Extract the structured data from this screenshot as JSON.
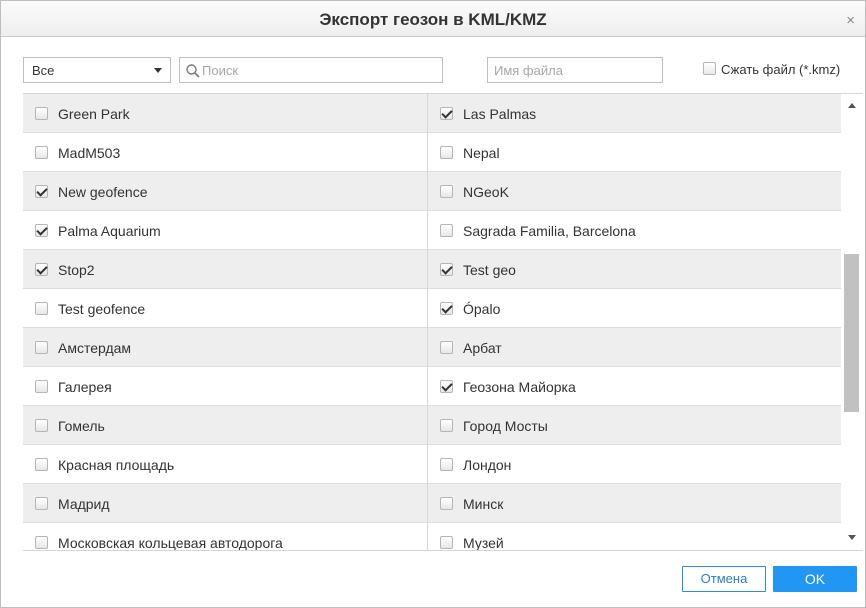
{
  "dialog": {
    "title": "Экспорт геозон в KML/KMZ",
    "close_glyph": "×"
  },
  "toolbar": {
    "filter_value": "Все",
    "search_placeholder": "Поиск",
    "filename_placeholder": "Имя файла",
    "compress_label": "Сжать файл (*.kmz)",
    "compress_checked": false
  },
  "geofences": [
    {
      "left": {
        "label": "Green Park",
        "checked": false
      },
      "right": {
        "label": "Las Palmas",
        "checked": true
      }
    },
    {
      "left": {
        "label": "MadM503",
        "checked": false
      },
      "right": {
        "label": "Nepal",
        "checked": false
      }
    },
    {
      "left": {
        "label": "New geofence",
        "checked": true
      },
      "right": {
        "label": "NGeoK",
        "checked": false
      }
    },
    {
      "left": {
        "label": "Palma Aquarium",
        "checked": true
      },
      "right": {
        "label": "Sagrada Familia, Barcelona",
        "checked": false
      }
    },
    {
      "left": {
        "label": "Stop2",
        "checked": true
      },
      "right": {
        "label": "Test geo",
        "checked": true
      }
    },
    {
      "left": {
        "label": "Test geofence",
        "checked": false
      },
      "right": {
        "label": "Ópalo",
        "checked": true
      }
    },
    {
      "left": {
        "label": "Амстердам",
        "checked": false
      },
      "right": {
        "label": "Арбат",
        "checked": false
      }
    },
    {
      "left": {
        "label": "Галерея",
        "checked": false
      },
      "right": {
        "label": "Геозона Майорка",
        "checked": true
      }
    },
    {
      "left": {
        "label": "Гомель",
        "checked": false
      },
      "right": {
        "label": "Город Мосты",
        "checked": false
      }
    },
    {
      "left": {
        "label": "Красная площадь",
        "checked": false
      },
      "right": {
        "label": "Лондон",
        "checked": false
      }
    },
    {
      "left": {
        "label": "Мадрид",
        "checked": false
      },
      "right": {
        "label": "Минск",
        "checked": false
      }
    },
    {
      "left": {
        "label": "Московская кольцевая автодорога",
        "checked": false
      },
      "right": {
        "label": "Музей",
        "checked": false
      }
    }
  ],
  "footer": {
    "cancel_label": "Отмена",
    "ok_label": "OK"
  },
  "icons": {
    "search": "search-icon",
    "dropdown": "chevron-down-icon",
    "close": "close-icon"
  },
  "colors": {
    "accent": "#2196f3",
    "row_alt": "#eeeeee"
  }
}
